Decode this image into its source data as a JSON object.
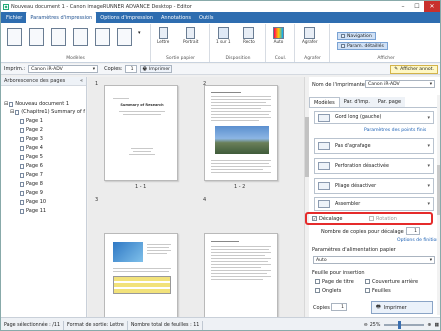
{
  "titlebar": {
    "title": "Nouveau document 1 - Canon imageRUNNER ADVANCE Desktop - Editor",
    "minimize": "–",
    "maximize": "☐",
    "close": "✕"
  },
  "ribbon_tabs": [
    {
      "label": "Fichier"
    },
    {
      "label": "Paramètres d'impression"
    },
    {
      "label": "Options d'impression"
    },
    {
      "label": "Annotations"
    },
    {
      "label": "Outils"
    }
  ],
  "ribbon_groups": {
    "modeles": "Modèles",
    "sortie_papier": "Sortie papier",
    "disposition": "Disposition",
    "coul": "Coul.",
    "agrafer": "Agrafer",
    "afficher": "Afficher"
  },
  "ribbon_buttons": {
    "portrait": "Portrait",
    "lettre": "Lettre",
    "un_sur_un": "1 sur 1",
    "recto": "Recto",
    "auto": "Auto",
    "agrafer": "Agrafer",
    "navigation": "Navigation",
    "param_details": "Param. détaillés"
  },
  "toolbar": {
    "imprim_label": "Imprim.:",
    "printer": "Canon iR-ADV",
    "copies_label": "Copies:",
    "copies_value": "1",
    "imprimer": "Imprimer",
    "afficher_annot": "Afficher annot."
  },
  "left_panel": {
    "header": "Arborescence des pages",
    "root": "Nouveau document 1",
    "chapter": "(Chapitre1) Summary of f",
    "pages": [
      "Page 1",
      "Page 2",
      "Page 3",
      "Page 4",
      "Page 5",
      "Page 6",
      "Page 7",
      "Page 8",
      "Page 9",
      "Page 10",
      "Page 11"
    ]
  },
  "pages_view": {
    "labels": [
      "1",
      "2",
      "3",
      "4"
    ],
    "captions": [
      "1 - 1",
      "1 - 2"
    ],
    "p1_title": "Summary of Research"
  },
  "right_panel": {
    "printer_label": "Nom de l'imprimante :",
    "printer_value": "Canon iR-ADV",
    "tabs": [
      "Modèles",
      "Par. d'imp.",
      "Par. page"
    ],
    "gord": "Gord long (gauche)",
    "link_finitions": "Paramètres des points finis",
    "agrafage": "Pas d'agrafage",
    "perforation": "Perforation désactivée",
    "pliage": "Pliage désactiver",
    "assembler": "Assembler",
    "decalage": "Décalage",
    "rotation": "Rotation",
    "copies_decalage": "Nombre de copies pour décalage :",
    "copies_decalage_value": "1",
    "link_options": "Options de finition",
    "alim_label": "Paramètres d'alimentation papier",
    "alim_value": "Auto",
    "insert_label": "Feuille pour insertion",
    "page_titre": "Page de titre",
    "couverture": "Couverture arrière",
    "onglets": "Onglets",
    "feuilles": "Feuilles",
    "copies_label": "Copies :",
    "copies_value": "1",
    "imprimer": "Imprimer"
  },
  "status": {
    "selected": "Page sélectionnée : /11",
    "format": "Format de sortie: Lettre",
    "total": "Nombre total de feuilles : 11",
    "zoom": "25%"
  }
}
